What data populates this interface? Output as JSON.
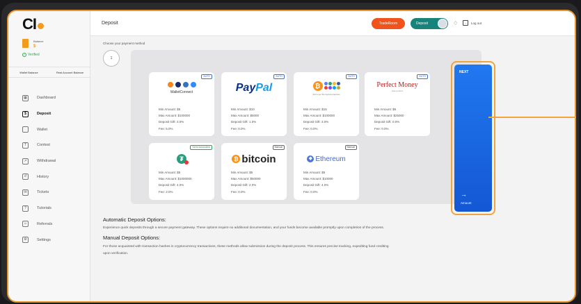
{
  "sidebar": {
    "logo": "CI",
    "balance_label": "Balance",
    "balance_value": "$",
    "verified": "Verified",
    "wallet_balance": "Wallet Balance",
    "real_account_balance": "Real Account Balance",
    "items": [
      {
        "label": "Dashboard",
        "icon": "dashboard-icon"
      },
      {
        "label": "Deposit",
        "icon": "deposit-icon"
      },
      {
        "label": "Wallet",
        "icon": "wallet-icon"
      },
      {
        "label": "Contest",
        "icon": "trophy-icon"
      },
      {
        "label": "Withdrawal",
        "icon": "withdrawal-icon"
      },
      {
        "label": "History",
        "icon": "history-icon"
      },
      {
        "label": "Tickets",
        "icon": "ticket-icon"
      },
      {
        "label": "Tutorials",
        "icon": "tutorial-icon"
      },
      {
        "label": "Referrals",
        "icon": "referral-icon"
      },
      {
        "label": "Settings",
        "icon": "gear-icon"
      }
    ]
  },
  "header": {
    "title": "Deposit",
    "trade_room": "TradeRoom",
    "deposit": "Deposit",
    "logout": "Log out"
  },
  "main": {
    "choose_label": "Choose your payment method",
    "step": "1",
    "next_label": "NEXT",
    "next_sub": "Amount",
    "next_arrow": "→",
    "methods": [
      {
        "name": "WalletConnect",
        "tag": "AUTO",
        "min": "Min Amount: $5",
        "max": "Max Amount: $100000",
        "gift": "Deposit Gift: 3.0%",
        "fee": "Fee: 5.0%"
      },
      {
        "name": "PayPal",
        "tag": "AUTO",
        "min": "Min Amount: $10",
        "max": "Max Amount: $5000",
        "gift": "Deposit Gift: 1.0%",
        "fee": "Fee: 0.0%"
      },
      {
        "name": "And over 50 cryptocurrencies",
        "tag": "AUTO",
        "min": "Min Amount: $15",
        "max": "Max Amount: $100000",
        "gift": "Deposit Gift: 3.0%",
        "fee": "Fee: 0.0%"
      },
      {
        "name": "Perfect Money",
        "sub": "best perfect",
        "tag": "AUTO",
        "min": "Min Amount: $5",
        "max": "Max Amount: $25000",
        "gift": "Deposit Gift: 0.0%",
        "fee": "Fee: 0.0%"
      },
      {
        "name": "Tether",
        "tag": "Semi Automated",
        "min": "Min Amount: $5",
        "max": "Max Amount: $1000000",
        "gift": "Deposit Gift: 4.0%",
        "fee": "Fee: 2.0%"
      },
      {
        "name": "bitcoin",
        "tag": "Manual",
        "min": "Min Amount: $5",
        "max": "Max Amount: $50000",
        "gift": "Deposit Gift: 2.0%",
        "fee": "Fee: 0.0%"
      },
      {
        "name": "Ethereum",
        "tag": "Manual",
        "min": "Min Amount: $5",
        "max": "Max Amount: $10000",
        "gift": "Deposit Gift: 4.0%",
        "fee": "Fee: 0.0%"
      }
    ],
    "auto_heading": "Automatic Deposit Options:",
    "auto_text": "Experience quick deposits through a secure payment gateway. These options require no additional documentation, and your funds become available promptly upon completion of the process.",
    "manual_heading": "Manual Deposit Options:",
    "manual_text_1": "For those acquainted with transaction hashes in cryptocurrency transactions, these methods allow submission during the deposit process. This ensures precise tracking, expediting fund crediting",
    "manual_text_2": "upon verification."
  },
  "colors": {
    "accent": "#f29b1e",
    "trade": "#f1531c",
    "deposit": "#17847c",
    "next": "#1a6ae6"
  }
}
